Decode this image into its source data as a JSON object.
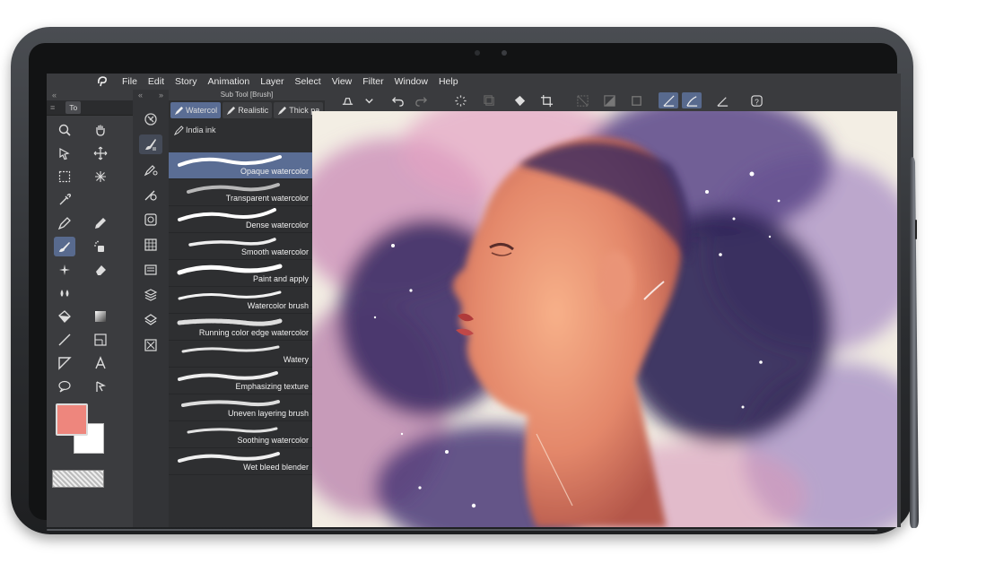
{
  "menu": {
    "items": [
      "File",
      "Edit",
      "Story",
      "Animation",
      "Layer",
      "Select",
      "View",
      "Filter",
      "Window",
      "Help"
    ]
  },
  "tool_panel": {
    "tab_label": "To",
    "collapse_left": "«",
    "collapse_right": "»"
  },
  "colors": {
    "main_color": "#ee867d",
    "sub_color": "#ffffff",
    "accent": "#5a6d94"
  },
  "subtool": {
    "title": "Sub Tool [Brush]",
    "tabs": [
      {
        "label": "Watercol",
        "active": true
      },
      {
        "label": "Realistic",
        "active": false
      },
      {
        "label": "Thick pa",
        "active": false
      }
    ],
    "tab_row2": "India ink",
    "brushes": [
      {
        "name": "Opaque watercolor",
        "active": true
      },
      {
        "name": "Transparent watercolor",
        "active": false
      },
      {
        "name": "Dense watercolor",
        "active": false
      },
      {
        "name": "Smooth watercolor",
        "active": false
      },
      {
        "name": "Paint and apply",
        "active": false
      },
      {
        "name": "Watercolor brush",
        "active": false
      },
      {
        "name": "Running color edge watercolor",
        "active": false
      },
      {
        "name": "Watery",
        "active": false
      },
      {
        "name": "Emphasizing texture",
        "active": false
      },
      {
        "name": "Uneven layering brush",
        "active": false
      },
      {
        "name": "Soothing watercolor",
        "active": false
      },
      {
        "name": "Wet bleed blender",
        "active": false
      }
    ]
  }
}
